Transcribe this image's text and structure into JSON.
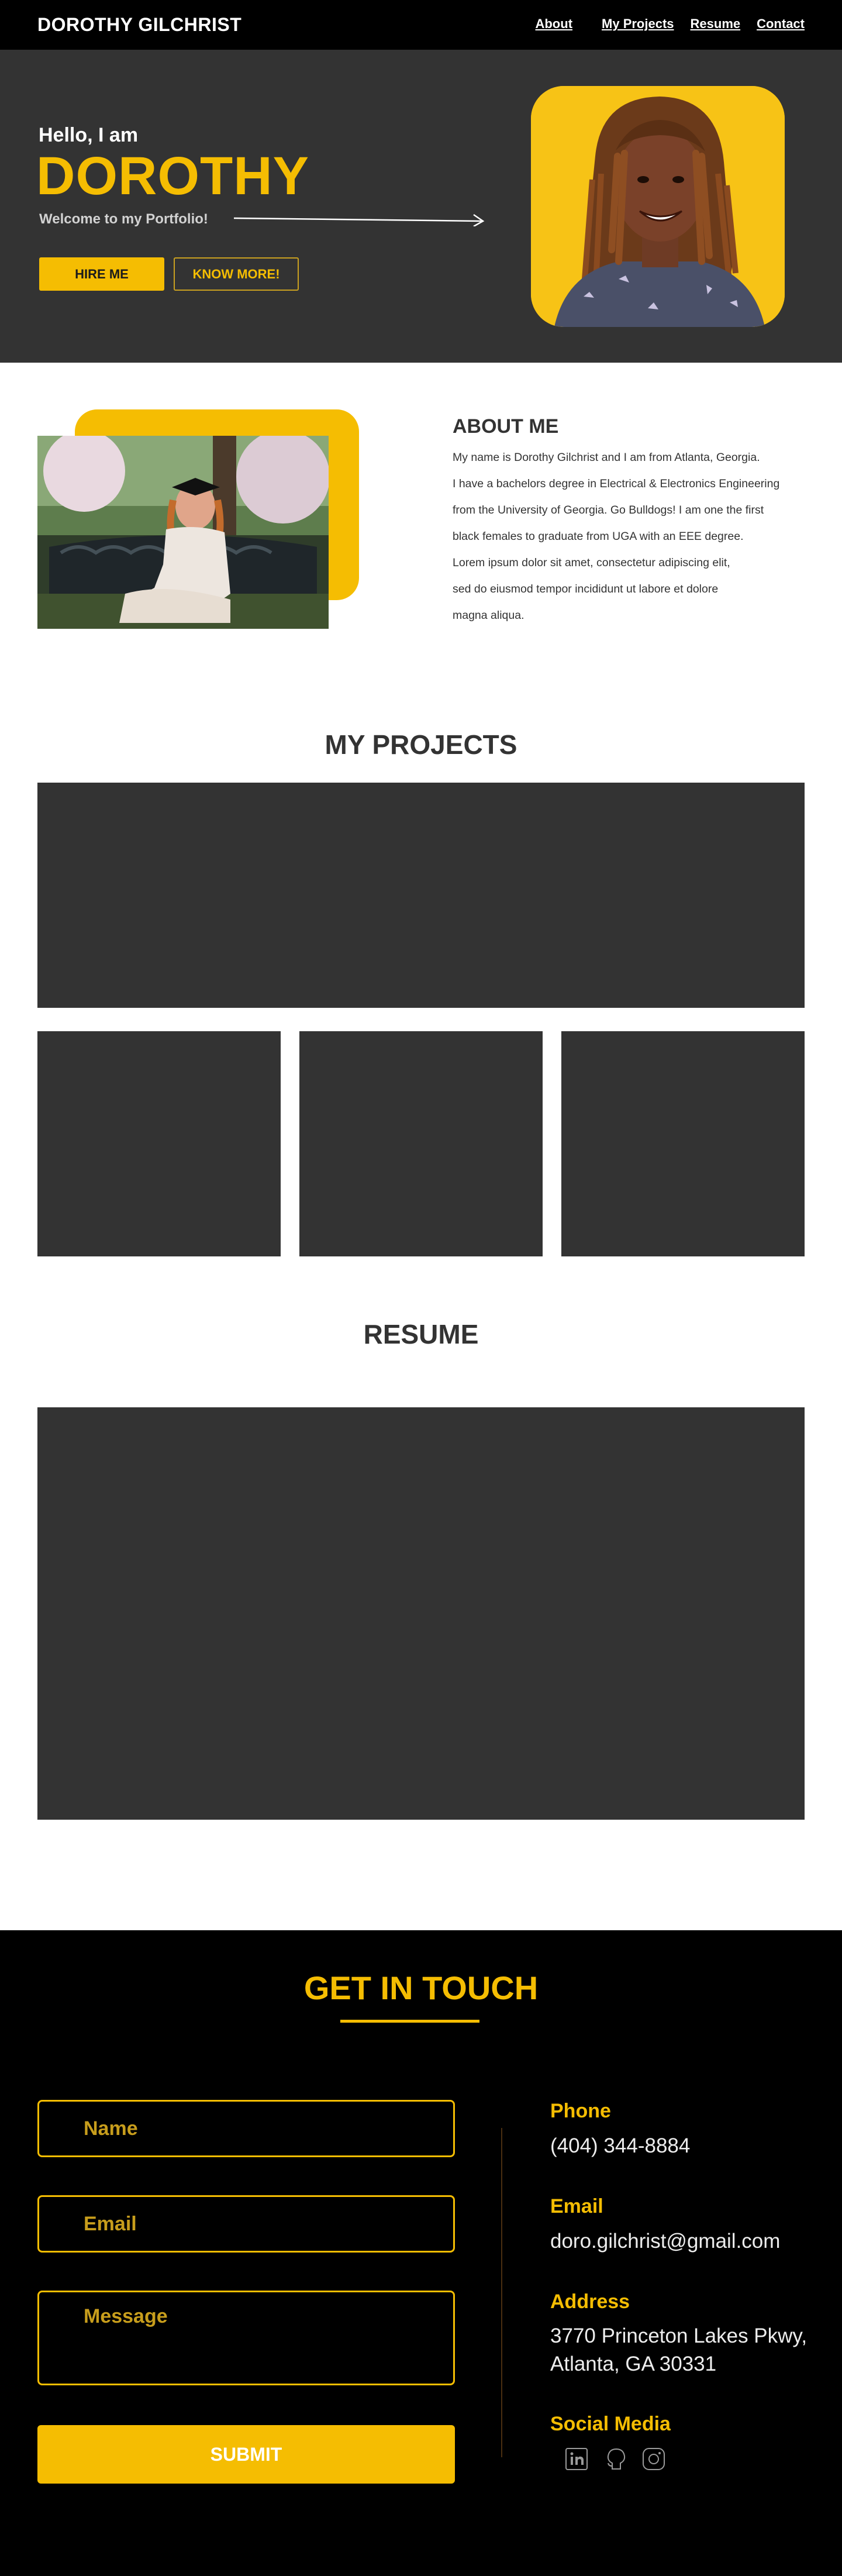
{
  "nav": {
    "brand": "DOROTHY GILCHRIST",
    "links": [
      "About",
      "My Projects",
      "Resume",
      "Contact"
    ]
  },
  "hero": {
    "greeting": "Hello, I am",
    "name": "DOROTHY",
    "tagline": "Welcome to my Portfolio!",
    "hire_label": "HIRE ME",
    "know_label": "KNOW MORE!"
  },
  "about": {
    "title": "ABOUT ME",
    "lines": [
      "My name is Dorothy Gilchrist and I am from Atlanta, Georgia.",
      "I have a bachelors degree in Electrical & Electronics Engineering",
      "from the University of Georgia. Go Bulldogs! I am one the first",
      "black females to graduate from UGA with an EEE degree.",
      "Lorem ipsum dolor sit amet, consectetur adipiscing elit,",
      "sed do eiusmod tempor incididunt ut labore et dolore",
      "magna aliqua."
    ]
  },
  "projects": {
    "title": "MY PROJECTS"
  },
  "resume": {
    "title": "RESUME"
  },
  "contact": {
    "title": "GET IN TOUCH",
    "name_placeholder": "Name",
    "email_placeholder": "Email",
    "message_placeholder": "Message",
    "submit_label": "SUBMIT",
    "phone_label": "Phone",
    "phone": "(404) 344-8884",
    "email_label": "Email",
    "email": "doro.gilchrist@gmail.com",
    "address_label": "Address",
    "address_line1": "3770 Princeton Lakes Pkwy,",
    "address_line2": "Atlanta, GA 30331",
    "social_label": "Social Media",
    "social_icons": [
      "linkedin-icon",
      "github-icon",
      "instagram-icon"
    ]
  },
  "colors": {
    "accent": "#f5bd02",
    "dark": "#333333",
    "black": "#000000"
  }
}
